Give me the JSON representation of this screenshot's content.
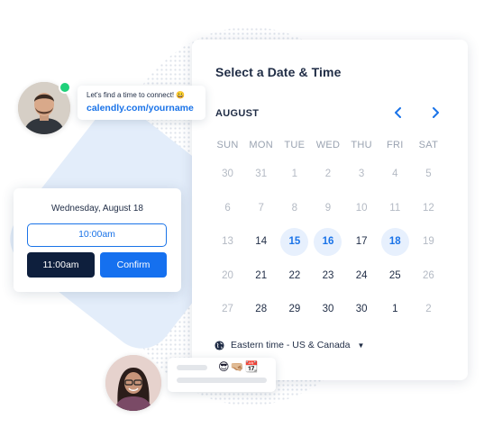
{
  "invite": {
    "message": "Let's find a time to connect! 😀",
    "link": "calendly.com/yourname"
  },
  "calendar": {
    "title": "Select a Date & Time",
    "month": "AUGUST",
    "prev_icon": "chevron-left-icon",
    "next_icon": "chevron-right-icon",
    "weekdays": [
      "SUN",
      "MON",
      "TUE",
      "WED",
      "THU",
      "FRI",
      "SAT"
    ],
    "weeks": [
      [
        {
          "d": "30",
          "s": "dim"
        },
        {
          "d": "31",
          "s": "dim"
        },
        {
          "d": "1",
          "s": "dim"
        },
        {
          "d": "2",
          "s": "dim"
        },
        {
          "d": "3",
          "s": "dim"
        },
        {
          "d": "4",
          "s": "dim"
        },
        {
          "d": "5",
          "s": "dim"
        }
      ],
      [
        {
          "d": "6",
          "s": "dim"
        },
        {
          "d": "7",
          "s": "dim"
        },
        {
          "d": "8",
          "s": "dim"
        },
        {
          "d": "9",
          "s": "dim"
        },
        {
          "d": "10",
          "s": "dim"
        },
        {
          "d": "11",
          "s": "dim"
        },
        {
          "d": "12",
          "s": "dim"
        }
      ],
      [
        {
          "d": "13",
          "s": "dim"
        },
        {
          "d": "14",
          "s": "act"
        },
        {
          "d": "15",
          "s": "avail"
        },
        {
          "d": "16",
          "s": "avail"
        },
        {
          "d": "17",
          "s": "act"
        },
        {
          "d": "18",
          "s": "avail"
        },
        {
          "d": "19",
          "s": "dim"
        }
      ],
      [
        {
          "d": "20",
          "s": "dim"
        },
        {
          "d": "21",
          "s": "act"
        },
        {
          "d": "22",
          "s": "act"
        },
        {
          "d": "23",
          "s": "act"
        },
        {
          "d": "24",
          "s": "act"
        },
        {
          "d": "25",
          "s": "act"
        },
        {
          "d": "26",
          "s": "dim"
        }
      ],
      [
        {
          "d": "27",
          "s": "dim"
        },
        {
          "d": "28",
          "s": "act"
        },
        {
          "d": "29",
          "s": "act"
        },
        {
          "d": "30",
          "s": "act"
        },
        {
          "d": "30",
          "s": "act"
        },
        {
          "d": "1",
          "s": "act"
        },
        {
          "d": "2",
          "s": "dim"
        }
      ]
    ],
    "timezone": "Eastern time - US & Canada"
  },
  "slot": {
    "date": "Wednesday, August 18",
    "time_option": "10:00am",
    "selected_time": "11:00am",
    "confirm_label": "Confirm"
  },
  "reply": {
    "emojis": "😎🤜🏼📆"
  },
  "colors": {
    "accent": "#1a73e8",
    "available_bg": "#e7f0fd",
    "dark_button": "#0e1f3d",
    "online": "#1fd17a"
  }
}
